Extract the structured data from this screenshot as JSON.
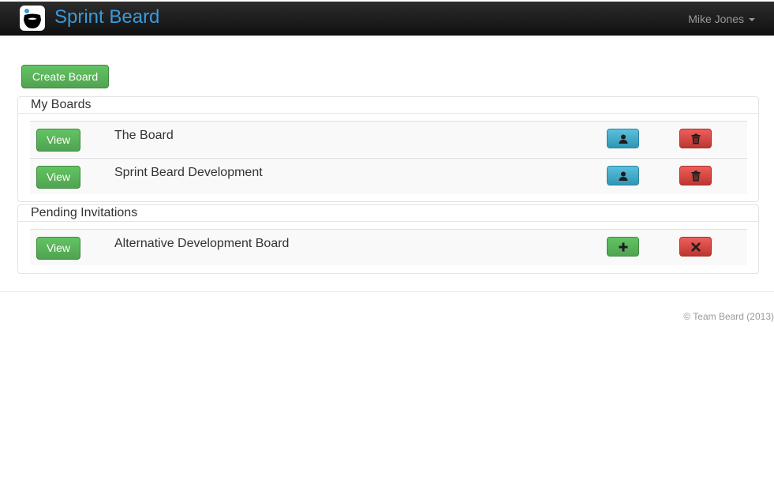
{
  "navbar": {
    "brand": "Sprint Beard",
    "user": "Mike Jones",
    "logo_icon": "beard-logo-icon"
  },
  "toolbar": {
    "create_label": "Create Board"
  },
  "my_boards": {
    "title": "My Boards",
    "rows": [
      {
        "view_label": "View",
        "name": "The Board",
        "action_a_icon": "user-icon",
        "action_b_icon": "trash-icon"
      },
      {
        "view_label": "View",
        "name": "Sprint Beard Development",
        "action_a_icon": "user-icon",
        "action_b_icon": "trash-icon"
      }
    ]
  },
  "pending": {
    "title": "Pending Invitations",
    "rows": [
      {
        "view_label": "View",
        "name": "Alternative Development Board",
        "action_a_icon": "plus-icon",
        "action_b_icon": "remove-icon"
      }
    ]
  },
  "footer": {
    "text": "© Team Beard (2013)"
  },
  "colors": {
    "brand": "#3a9ad9",
    "success": "#5bb75b",
    "info": "#49afcd",
    "danger": "#da4f49",
    "navbar": "#1b1b1b"
  }
}
